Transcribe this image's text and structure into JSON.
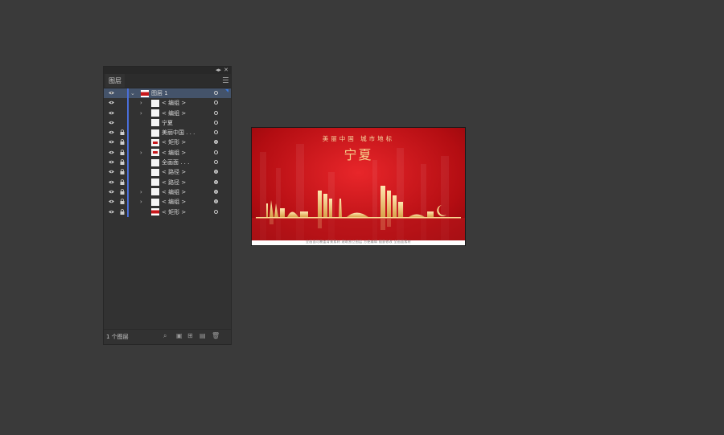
{
  "panel": {
    "tab_label": "图层",
    "footer_text": "1 个图层",
    "layers": [
      {
        "label": "图层 1",
        "lock": false,
        "expander": "down",
        "indent": 0,
        "thumb": "red",
        "target": "hollow",
        "selected": true
      },
      {
        "label": "< 编组 >",
        "lock": false,
        "expander": "right",
        "indent": 1,
        "thumb": "white",
        "target": "hollow"
      },
      {
        "label": "< 编组 >",
        "lock": false,
        "expander": "right",
        "indent": 1,
        "thumb": "white",
        "target": "hollow"
      },
      {
        "label": "宁夏",
        "lock": false,
        "expander": "",
        "indent": 1,
        "thumb": "white",
        "target": "hollow"
      },
      {
        "label": "美丽中国 . . .",
        "lock": true,
        "expander": "",
        "indent": 1,
        "thumb": "white",
        "target": "hollow"
      },
      {
        "label": "< 矩形 >",
        "lock": true,
        "expander": "",
        "indent": 1,
        "thumb": "shape",
        "target": "filled"
      },
      {
        "label": "< 编组 >",
        "lock": true,
        "expander": "right",
        "indent": 1,
        "thumb": "shape",
        "target": "hollow"
      },
      {
        "label": "全画面 . . .",
        "lock": true,
        "expander": "",
        "indent": 1,
        "thumb": "white",
        "target": "hollow"
      },
      {
        "label": "< 路径 >",
        "lock": true,
        "expander": "",
        "indent": 1,
        "thumb": "white",
        "target": "filled"
      },
      {
        "label": "< 路径 >",
        "lock": true,
        "expander": "",
        "indent": 1,
        "thumb": "white",
        "target": "filled"
      },
      {
        "label": "< 编组 >",
        "lock": true,
        "expander": "right",
        "indent": 1,
        "thumb": "white",
        "target": "filled"
      },
      {
        "label": "< 编组 >",
        "lock": true,
        "expander": "right",
        "indent": 1,
        "thumb": "white",
        "target": "filled"
      },
      {
        "label": "< 矩形 >",
        "lock": true,
        "expander": "",
        "indent": 1,
        "thumb": "red",
        "target": "hollow"
      }
    ]
  },
  "artwork": {
    "top_text": "美丽中国  城市地标",
    "title": "宁夏",
    "bottom_text": "全画面可覆盖背景素材  建筑独立图层  方便编辑  随意修改  全画面素材",
    "colors": {
      "red": "#c8181c",
      "gold": "#f7d38d",
      "accent": "#4a6ed8"
    }
  }
}
